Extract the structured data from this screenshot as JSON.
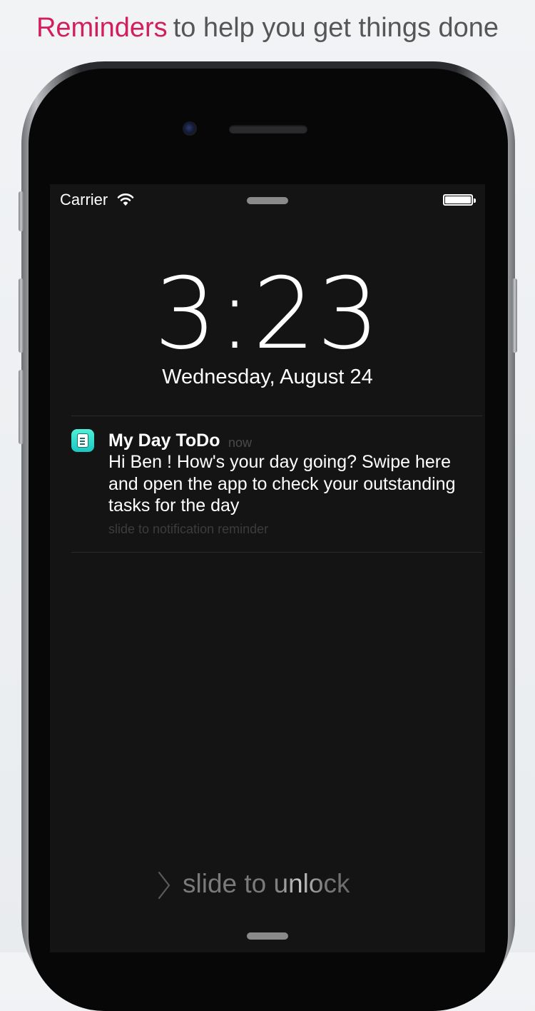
{
  "headline": {
    "accent": "Reminders",
    "rest": "to help you get things done"
  },
  "status_bar": {
    "carrier": "Carrier",
    "wifi_icon": "wifi-icon",
    "battery_icon": "battery-full-icon",
    "battery_level": 1.0
  },
  "lock_screen": {
    "time": "3:23",
    "date": "Wednesday, August 24"
  },
  "notification": {
    "app_icon": "notepad-icon",
    "app_name": "My Day ToDo",
    "time": "now",
    "message": "Hi Ben ! How's your day going? Swipe here and open the app to check your outstanding tasks for the day",
    "action_hint": "slide to notification reminder"
  },
  "unlock": {
    "icon": "chevron-right-icon",
    "label": "slide to unlock"
  },
  "colors": {
    "accent": "#d21f5b",
    "headline_text": "#555658",
    "screen_background": "#141414",
    "app_icon": "#2fd9cc"
  }
}
